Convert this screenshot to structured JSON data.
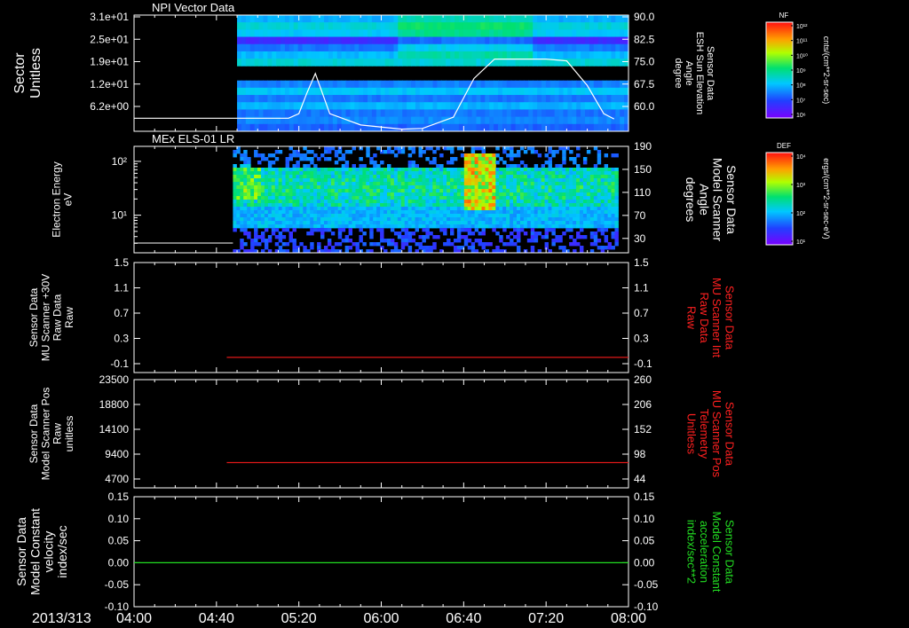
{
  "date_label": "2013/313",
  "time_ticks": [
    "04:00",
    "04:40",
    "05:20",
    "06:00",
    "06:40",
    "07:20",
    "08:00"
  ],
  "colors": {
    "axis": "#ffffff",
    "red_series": "#e01818",
    "green_series": "#22dd22",
    "right_label_red": "#ff2020",
    "right_label_green": "#22dd22"
  },
  "colorbars": [
    {
      "title": "NF",
      "unit": "cnts/(cm**2-sr-sec)",
      "ticks": [
        "10¹²",
        "10¹¹",
        "10¹⁰",
        "10⁹",
        "10⁸",
        "10⁷",
        "10⁶"
      ]
    },
    {
      "title": "DEF",
      "unit": "ergs/(cm**2-sr-sec-eV)",
      "ticks": [
        "10⁴",
        "10³",
        "10²",
        "10¹"
      ]
    }
  ],
  "chart_data": [
    {
      "type": "heatmap",
      "title": "NPI Vector Data",
      "ylabel": [
        "Sector",
        "Unitless"
      ],
      "y_ticks": [
        "3.1e+01",
        "2.5e+01",
        "1.9e+01",
        "1.2e+01",
        "6.2e+00"
      ],
      "data_start": "04:50",
      "data_end": "08:00",
      "right_axis": {
        "label": [
          "Sensor Data",
          "ESH Sun Elevation",
          "Angle",
          "degree"
        ],
        "ticks": [
          "90.0",
          "82.5",
          "75.0",
          "67.5",
          "60.0"
        ],
        "range": [
          57.0,
          90.0
        ]
      },
      "overlay_line": {
        "x": [
          "04:00",
          "05:15",
          "05:20",
          "05:24",
          "05:28",
          "05:35",
          "05:50",
          "06:10",
          "06:20",
          "06:35",
          "06:45",
          "06:55",
          "07:10",
          "07:20",
          "07:30",
          "07:40",
          "07:48",
          "07:53"
        ],
        "y": [
          60.7,
          60.7,
          62.0,
          68.0,
          73.4,
          62.0,
          58.8,
          57.6,
          57.8,
          61.0,
          72.0,
          77.5,
          77.5,
          77.5,
          77.0,
          70.0,
          62.0,
          60.5
        ]
      },
      "palette_note": "counts shown in blue-cyan range; colorbar NF"
    },
    {
      "type": "heatmap",
      "title": "MEx ELS-01 LR",
      "ylabel": [
        "Electron Energy",
        "eV"
      ],
      "y_ticks": [
        "10²",
        "10¹"
      ],
      "ylim": [
        2,
        190
      ],
      "yscale": "log",
      "data_start": "04:48",
      "data_end": "07:55",
      "right_axis": {
        "label": [
          "Sensor Data",
          "Model Scanner",
          "Angle",
          "degrees"
        ],
        "ticks": [
          "190",
          "150",
          "110",
          "70",
          "30"
        ],
        "range": [
          5,
          190
        ]
      },
      "overlay_line": {
        "x": [
          "04:00",
          "04:48"
        ],
        "y": [
          12,
          12
        ]
      },
      "hotspot": {
        "from": "06:40",
        "to": "06:55",
        "energy_eV": 60
      }
    },
    {
      "type": "line",
      "ylabel": [
        "Sensor Data",
        "MU Scanner +30V",
        "Raw Data",
        "Raw"
      ],
      "left_ticks": [
        "1.5",
        "1.1",
        "0.7",
        "0.3",
        "-0.1"
      ],
      "ylim": [
        -0.3,
        1.5
      ],
      "right_axis": {
        "label": [
          "Sensor Data",
          "MU Scanner Int",
          "Raw Data",
          "Raw"
        ],
        "ticks": [
          "1.5",
          "1.1",
          "0.7",
          "0.3",
          "-0.1"
        ],
        "color": "red"
      },
      "series": [
        {
          "x": [
            "04:45",
            "08:00"
          ],
          "y": [
            0.0,
            0.0
          ],
          "color": "red"
        }
      ]
    },
    {
      "type": "line",
      "ylabel": [
        "Sensor Data",
        "Model Scanner Pos",
        "Raw",
        "unitless"
      ],
      "left_ticks": [
        "23500",
        "18800",
        "14100",
        "9400",
        "4700"
      ],
      "ylim": [
        0,
        23500
      ],
      "right_axis": {
        "label": [
          "Sensor Data",
          "MU Scanner Pos",
          "Telemetry",
          "Unitless"
        ],
        "ticks": [
          "260",
          "206",
          "152",
          "98",
          "44"
        ],
        "color": "red"
      },
      "series": [
        {
          "x": [
            "04:45",
            "08:00"
          ],
          "y": [
            7800,
            7800
          ],
          "color": "red"
        }
      ]
    },
    {
      "type": "line",
      "ylabel": [
        "Sensor Data",
        "Model Constant",
        "velocity",
        "index/sec"
      ],
      "left_ticks": [
        "0.15",
        "0.10",
        "0.05",
        "0.00",
        "-0.05",
        "-0.10"
      ],
      "ylim": [
        -0.1,
        0.15
      ],
      "right_axis": {
        "label": [
          "Sensor Data",
          "Model Constant",
          "acceleration",
          "index/sec**2"
        ],
        "ticks": [
          "0.15",
          "0.10",
          "0.05",
          "0.00",
          "-0.05",
          "-0.10"
        ],
        "color": "green"
      },
      "series": [
        {
          "x": [
            "04:00",
            "08:00"
          ],
          "y": [
            0.0,
            0.0
          ],
          "color": "green"
        }
      ]
    }
  ]
}
